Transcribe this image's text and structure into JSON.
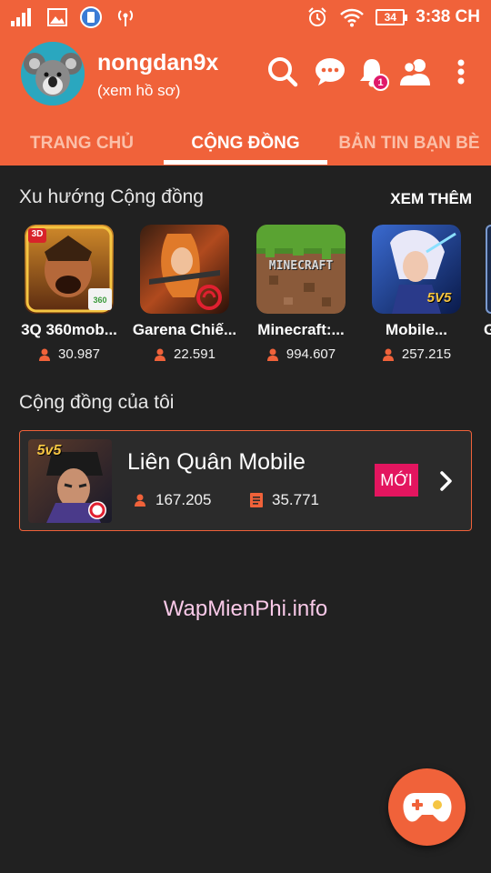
{
  "status_bar": {
    "battery": "34",
    "time": "3:38 CH"
  },
  "header": {
    "username": "nongdan9x",
    "profile_link": "(xem hồ sơ)",
    "notification_count": "1",
    "icons": [
      "search-icon",
      "chat-icon",
      "bell-icon",
      "friends-icon",
      "more-icon"
    ],
    "brand_color": "#f0623a"
  },
  "tabs": [
    {
      "label": "TRANG CHỦ"
    },
    {
      "label": "CỘNG ĐỒNG"
    },
    {
      "label": "BẢN TIN BẠN BÈ"
    }
  ],
  "trending": {
    "title": "Xu hướng Cộng đồng",
    "see_more": "XEM THÊM",
    "games": [
      {
        "name": "3Q 360mob...",
        "members": "30.987",
        "tag": "3D",
        "tag2": "360"
      },
      {
        "name": "Garena Chiế...",
        "members": "22.591"
      },
      {
        "name": "Minecraft:...",
        "members": "994.607",
        "logo": "MINECRAFT"
      },
      {
        "name": "Mobile...",
        "members": "257.215",
        "tag": "5V5"
      },
      {
        "name": "G"
      }
    ]
  },
  "my_community": {
    "title": "Cộng đồng của tôi",
    "item": {
      "name": "Liên Quân Mobile",
      "thumb_tag": "5v5",
      "members": "167.205",
      "posts": "35.771",
      "new_label": "MỚI"
    }
  },
  "watermark": "WapMienPhi.info"
}
